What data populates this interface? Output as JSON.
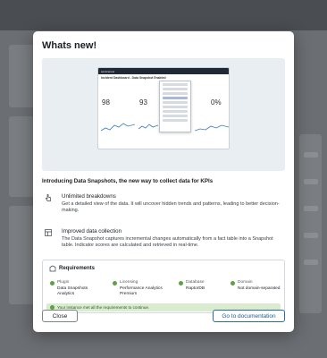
{
  "modal": {
    "title": "Whats new!",
    "intro": "Introducing Data Snapshots, the new way to collect data for KPIs",
    "features": [
      {
        "icon": "pointer-icon",
        "name": "Unlimited breakdowns",
        "description": "Get a detailed view of the data. It will uncover hidden trends and patterns, leading to better decision-making."
      },
      {
        "icon": "table-icon",
        "name": "Improved data collection",
        "description": "The Data Snapshot captures incremental changes automatically from a fact table into a Snapshot table. Indicator scores are calculated and retrieved in real-time."
      }
    ],
    "requirements": {
      "title": "Requirements",
      "items": [
        {
          "label": "Plugin",
          "value": "Data Snapshots Analytics",
          "status": "met"
        },
        {
          "label": "Licensing",
          "value": "Performance Analytics Premium",
          "status": "met"
        },
        {
          "label": "Database",
          "value": "RaptorDB",
          "status": "met"
        },
        {
          "label": "Domain",
          "value": "Not domain-separated",
          "status": "met"
        }
      ],
      "banner": "Your instance met all the requirements to continue."
    },
    "buttons": {
      "close": "Close",
      "documentation": "Go to documentation"
    }
  },
  "preview": {
    "brand": "servicenow",
    "dashboard_title": "Incident Dashboard - Data Snapshot Enabled",
    "kpi_values": [
      "98",
      "93",
      "0%"
    ]
  },
  "colors": {
    "success": "#5f9f45",
    "link": "#1c5a96"
  }
}
